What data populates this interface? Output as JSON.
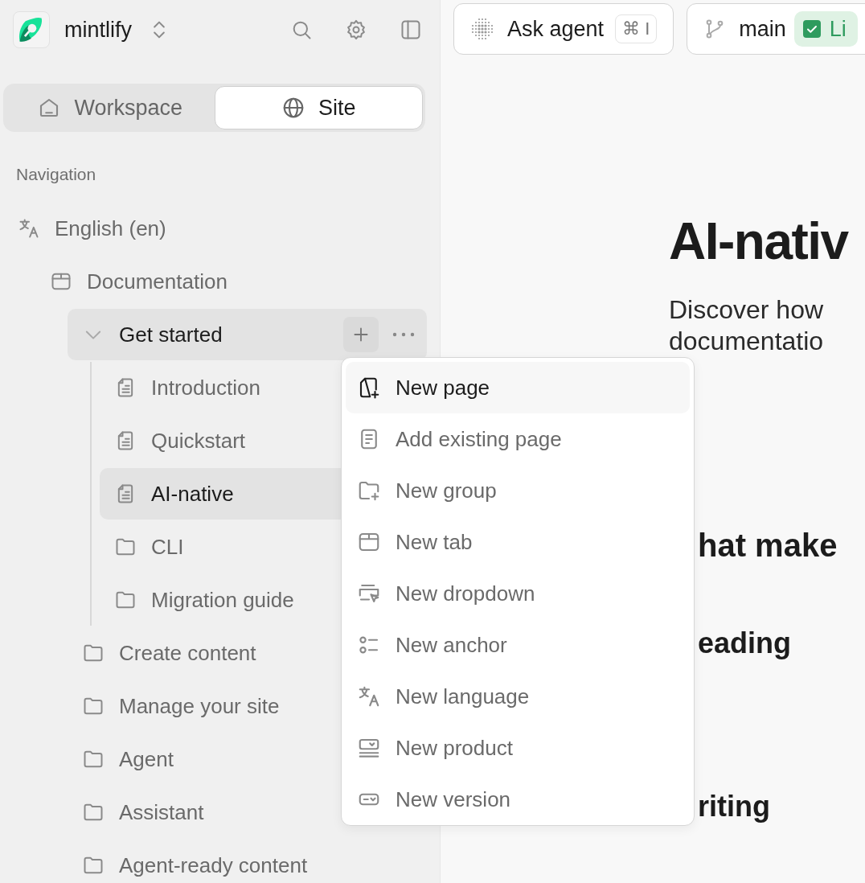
{
  "sidebar": {
    "org": {
      "name": "mintlify"
    },
    "switcher": [
      {
        "kind": "workspace",
        "label": "Workspace",
        "selected": false
      },
      {
        "kind": "site",
        "label": "Site",
        "selected": true
      }
    ],
    "navigation": {
      "label": "Navigation",
      "tree": [
        {
          "kind": "language",
          "label": "English (en)",
          "selected": false,
          "hovered": false,
          "children": [
            {
              "kind": "tab",
              "label": "Documentation",
              "selected": false,
              "hovered": false,
              "children": [
                {
                  "kind": "group",
                  "label": "Get started",
                  "selected": false,
                  "hovered": true,
                  "expanded": true,
                  "children": [
                    {
                      "kind": "page",
                      "label": "Introduction",
                      "selected": false,
                      "hovered": false
                    },
                    {
                      "kind": "page",
                      "label": "Quickstart",
                      "selected": false,
                      "hovered": false
                    },
                    {
                      "kind": "page",
                      "label": "AI-native",
                      "selected": true,
                      "hovered": false
                    },
                    {
                      "kind": "folder",
                      "label": "CLI",
                      "selected": false,
                      "hovered": false
                    },
                    {
                      "kind": "folder",
                      "label": "Migration guide",
                      "selected": false,
                      "hovered": false
                    }
                  ]
                },
                {
                  "kind": "folder",
                  "label": "Create content",
                  "selected": false,
                  "hovered": false
                },
                {
                  "kind": "folder",
                  "label": "Manage your site",
                  "selected": false,
                  "hovered": false
                },
                {
                  "kind": "folder",
                  "label": "Agent",
                  "selected": false,
                  "hovered": false
                },
                {
                  "kind": "folder",
                  "label": "Assistant",
                  "selected": false,
                  "hovered": false
                },
                {
                  "kind": "folder",
                  "label": "Agent-ready content",
                  "selected": false,
                  "hovered": false
                }
              ]
            }
          ]
        }
      ]
    }
  },
  "toolbar": {
    "ask_agent": {
      "label": "Ask agent",
      "shortcut": "⌘ I"
    },
    "branch": {
      "name": "main",
      "status": "Li"
    }
  },
  "page": {
    "title": "AI-nativ",
    "lines": [
      "Discover how",
      "documentatio"
    ],
    "headings": [
      {
        "kind": "h2",
        "text": "hat make"
      },
      {
        "kind": "h3",
        "text": "eading"
      },
      {
        "kind": "h3",
        "text": "riting"
      }
    ]
  },
  "context_menu": {
    "items": [
      {
        "kind": "new-page",
        "label": "New page",
        "highlighted": true
      },
      {
        "kind": "existing-page",
        "label": "Add existing page",
        "highlighted": false
      },
      {
        "kind": "group",
        "label": "New group",
        "highlighted": false
      },
      {
        "kind": "tab",
        "label": "New tab",
        "highlighted": false
      },
      {
        "kind": "dropdown",
        "label": "New dropdown",
        "highlighted": false
      },
      {
        "kind": "anchor",
        "label": "New anchor",
        "highlighted": false
      },
      {
        "kind": "language",
        "label": "New language",
        "highlighted": false
      },
      {
        "kind": "product",
        "label": "New product",
        "highlighted": false
      },
      {
        "kind": "version",
        "label": "New version",
        "highlighted": false
      }
    ]
  }
}
